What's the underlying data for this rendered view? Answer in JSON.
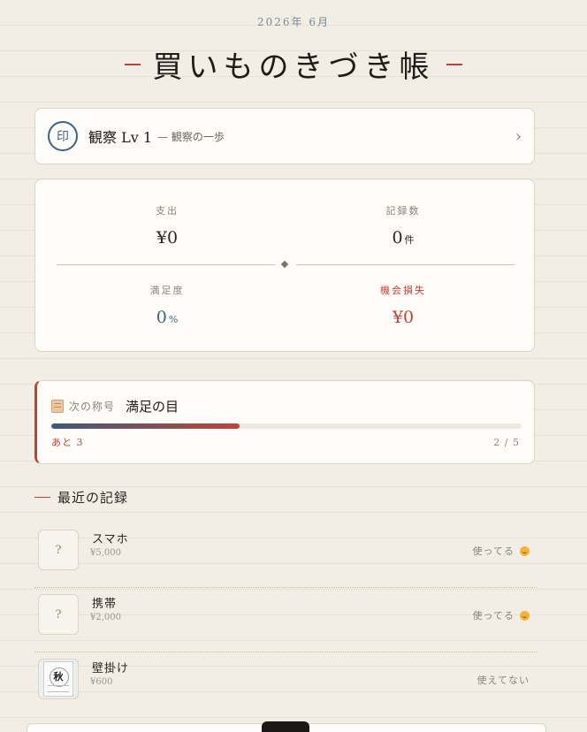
{
  "header": {
    "date": "2026年 6月",
    "title": "買いものきづき帳"
  },
  "level": {
    "seal": "印",
    "name": "観察 Lv 1",
    "subtitle": "— 観察の一歩",
    "chevron": "›"
  },
  "stats": {
    "spending": {
      "label": "支出",
      "value": "¥0"
    },
    "records": {
      "label": "記録数",
      "value": "0",
      "unit": "件"
    },
    "satisfaction": {
      "label": "満足度",
      "value": "0",
      "unit": "%"
    },
    "opportunity_loss": {
      "label": "機会損失",
      "value": "¥0"
    }
  },
  "next_title": {
    "label": "次の称号",
    "name": "満足の目",
    "remaining": "あと 3",
    "progress_text": "2 / 5",
    "progress": 0.4
  },
  "recent": {
    "heading": "最近の記録",
    "items": [
      {
        "name": "スマホ",
        "price": "¥5,000",
        "status": "使ってる",
        "thumb": "?"
      },
      {
        "name": "携帯",
        "price": "¥2,000",
        "status": "使ってる",
        "thumb": "?"
      },
      {
        "name": "壁掛け",
        "price": "¥600",
        "status": "使えてない",
        "thumb_kanji": "秋"
      }
    ]
  },
  "colors": {
    "accent": "#b8433a",
    "navy": "#3d6282",
    "background": "#f2eee6"
  }
}
